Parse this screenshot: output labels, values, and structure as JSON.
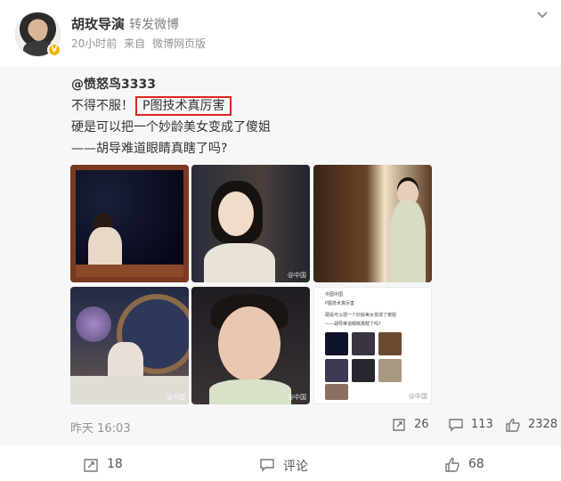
{
  "post": {
    "author": "胡玫导演",
    "action": "转发微博",
    "time": "20小时前",
    "source_prefix": "来自",
    "source": "微博网页版",
    "verified_badge": "V"
  },
  "original": {
    "author": "@愤怒鸟3333",
    "line1_prefix": "不得不服！",
    "line1_highlight": "P图技术真厉害",
    "line2": "硬是可以把一个妙龄美女变成了傻姐",
    "line3": "——胡导难道眼睛真瞎了吗?",
    "time": "昨天 16:03",
    "reposts": "26",
    "comments": "113",
    "likes": "2328",
    "watermark": "@中国"
  },
  "thumb6": {
    "line_a": "中国中国",
    "line_b": "P图技术真厉害",
    "line_c": "硬是可以把一个妙龄美女变成了傻姐",
    "line_d": "——胡导难道眼睛真瞎了吗?"
  },
  "footer": {
    "repost_count": "18",
    "comment_label": "评论",
    "like_count": "68"
  },
  "icons": {
    "more": "chevron-down-icon",
    "repost": "repost-icon",
    "comment": "comment-icon",
    "like": "thumbs-up-icon"
  },
  "colors": {
    "highlight_border": "#e0251b",
    "repost_bg": "#f7f7f7",
    "verified": "#f7b500"
  }
}
